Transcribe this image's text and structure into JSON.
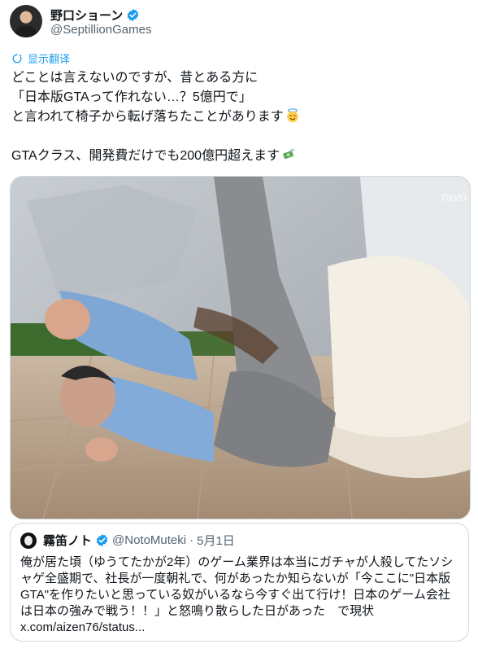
{
  "author": {
    "display_name": "野口ショーン",
    "handle": "@SeptillionGames"
  },
  "translate_label": "显示翻译",
  "tweet_lines": [
    "どことは言えないのですが、昔とある方に",
    "「日本版GTAって作れない…？5億円で」",
    "と言われて椅子から転げ落ちたことがあります",
    "",
    "GTAクラス、開発費だけでも200億円超えます"
  ],
  "media_watermark": "ravo",
  "quote": {
    "display_name": "霧笛ノト",
    "handle": "@NotoMuteki",
    "separator": "·",
    "date": "5月1日",
    "lines": [
      "俺が居た頃（ゆうてたかが2年）のゲーム業界は本当にガチャが人殺してたソシ",
      "ャゲ全盛期で、社長が一度朝礼で、何があったか知らないが「今ここに\"日本版",
      "GTA\"を作りたいと思っている奴がいるなら今すぐ出て行け！日本のゲーム会社",
      "は日本の強みで戦う！！」と怒鳴り散らした日があった　で現状",
      "x.com/aizen76/status..."
    ]
  },
  "colors": {
    "accent": "#1d9bf0",
    "text": "#0f1419",
    "secondary": "#536471",
    "border": "#cfd9de"
  },
  "icons": [
    "verified-badge-icon",
    "translate-icon",
    "halo-smile-emoji",
    "money-wings-emoji"
  ]
}
